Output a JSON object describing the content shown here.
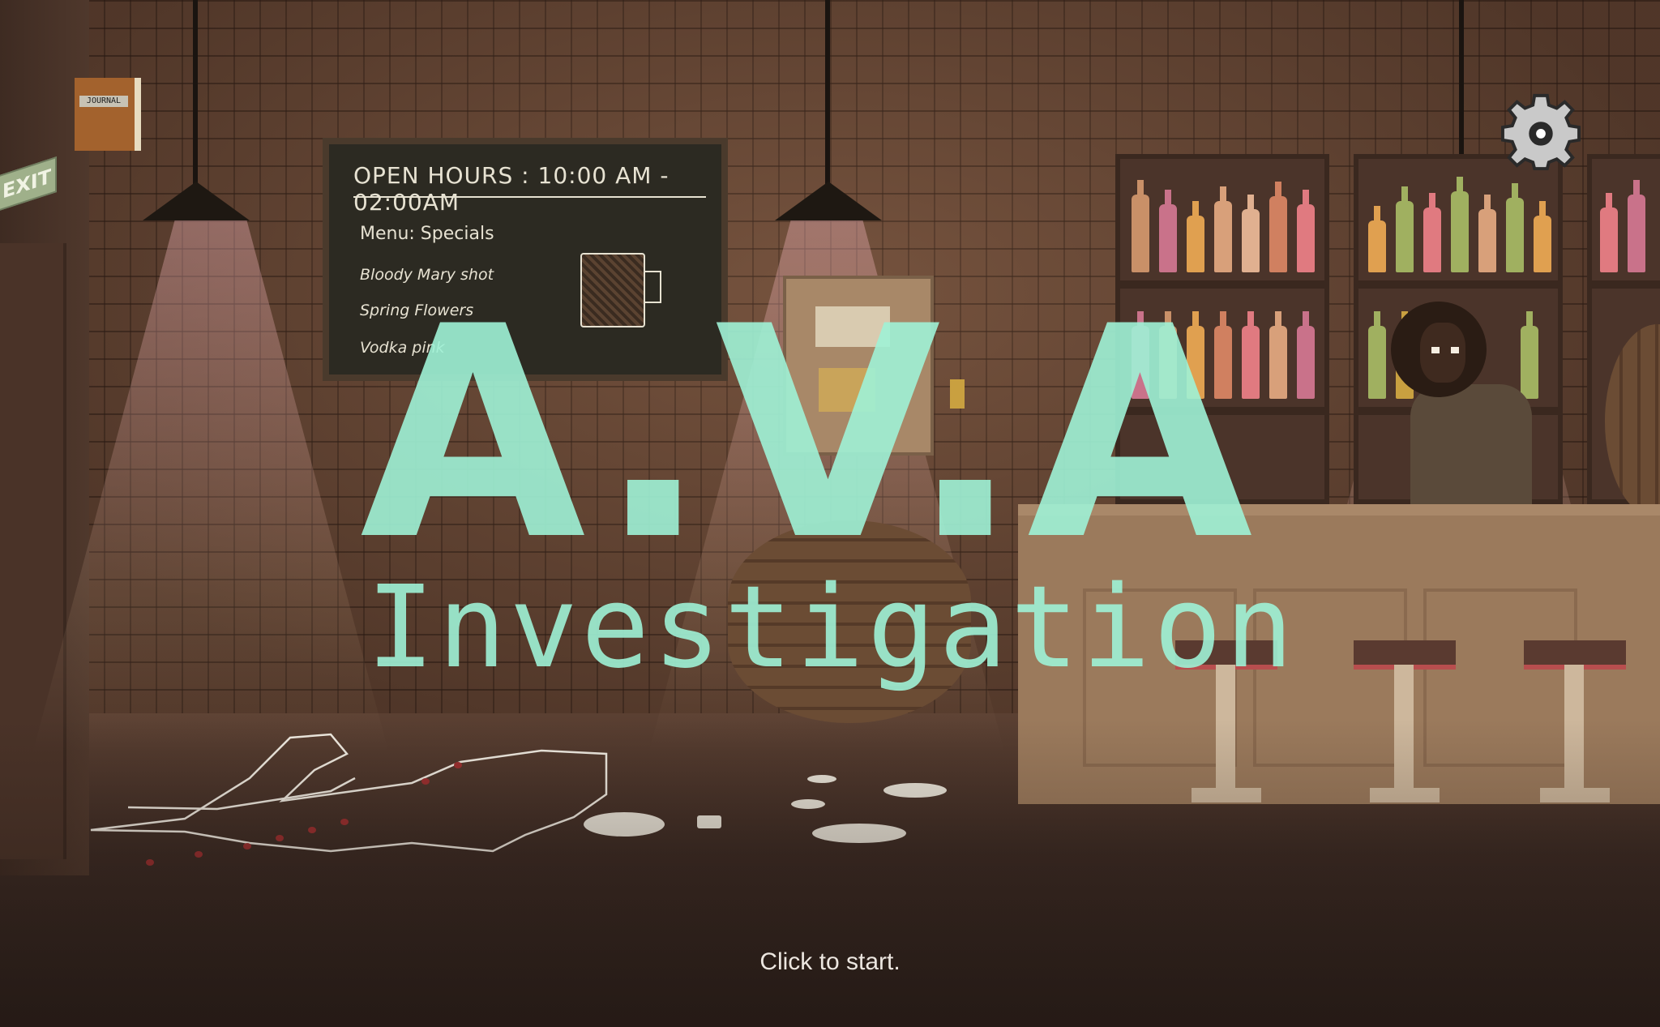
{
  "game": {
    "title": "A.V.A",
    "subtitle": "Investigation",
    "start_prompt": "Click to start.",
    "title_color": "#9ef2d6"
  },
  "scene": {
    "exit_sign": "EXIT",
    "journal_label": "JOURNAL",
    "chalkboard": {
      "hours": "OPEN HOURS : 10:00 AM - 02:00AM",
      "menu_heading": "Menu: Specials",
      "items": [
        "Bloody Mary shot",
        "Spring Flowers",
        "Vodka pink"
      ]
    }
  },
  "icons": {
    "settings": "gear-icon",
    "journal": "journal-icon"
  }
}
